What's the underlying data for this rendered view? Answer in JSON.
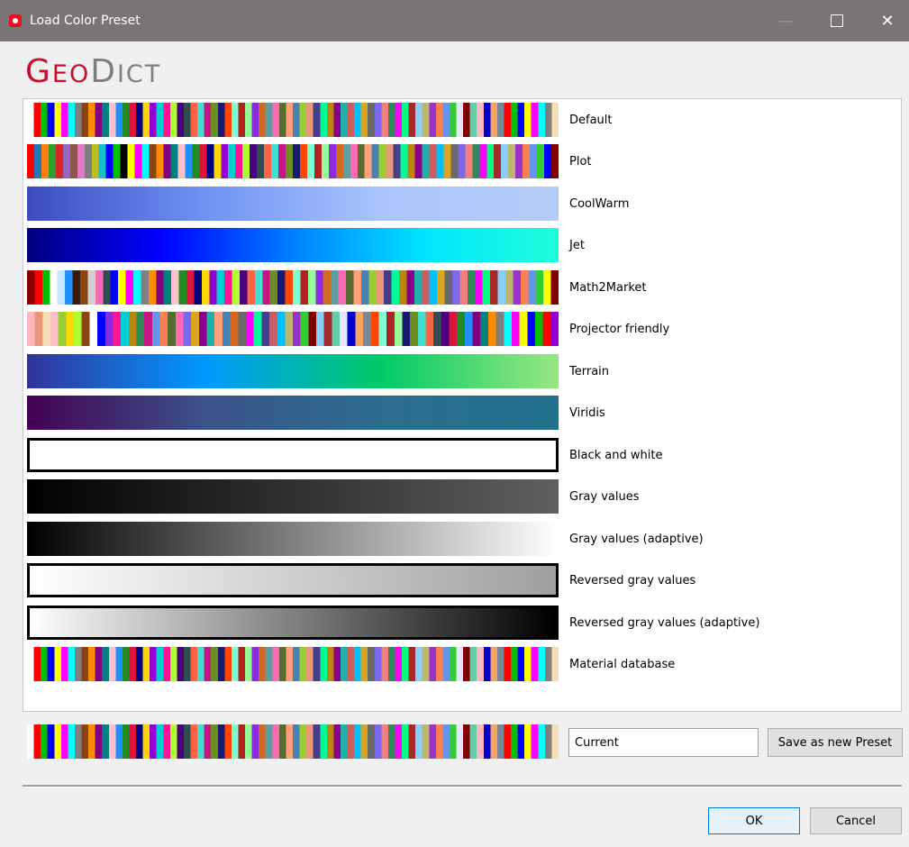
{
  "window": {
    "title": "Load Color Preset",
    "controls": {
      "minimize": "—",
      "close": "✕"
    }
  },
  "logo": {
    "part1_big": "G",
    "part1_small": "EO",
    "part2_big": "D",
    "part2_small": "ICT"
  },
  "presets": [
    {
      "label": "Default",
      "colors": [
        "#ffffff",
        "#ff0000",
        "#00c000",
        "#0000ff",
        "#ffff00",
        "#ff00ff",
        "#00ffff",
        "#808080",
        "#8b4513",
        "#ff8c00",
        "#800080",
        "#008080",
        "#ffc0cb",
        "#1e90ff",
        "#228b22",
        "#dc143c",
        "#000080",
        "#ffd700",
        "#9400d3",
        "#00ced1",
        "#ff1493",
        "#adff2f",
        "#4b0082",
        "#2f4f4f",
        "#ff6347",
        "#40e0d0",
        "#c71585",
        "#6b8e23",
        "#191970",
        "#ff4500",
        "#7fffd4",
        "#b22222",
        "#98fb98",
        "#8a2be2",
        "#d2691e",
        "#5f9ea0",
        "#ff69b4",
        "#556b2f",
        "#ffa07a",
        "#4682b4",
        "#9acd32",
        "#e9967a",
        "#483d8b",
        "#00fa9a",
        "#b8860b",
        "#8b008b",
        "#20b2aa",
        "#cd5c5c",
        "#00bfff",
        "#daa520",
        "#696969",
        "#7b68ee",
        "#f08080",
        "#2e8b57",
        "#ff00ff",
        "#00ff7f",
        "#a52a2a",
        "#87cefa",
        "#bdb76b",
        "#9932cc",
        "#ff7f50",
        "#6495ed",
        "#32cd32",
        "#e6e6fa",
        "#800000",
        "#66cdaa",
        "#ffb6c1",
        "#0000cd",
        "#f4a460",
        "#778899",
        "#ff0000",
        "#00c000",
        "#0000ff",
        "#ffff00",
        "#ff00ff",
        "#00ffff",
        "#808080",
        "#f5deb3"
      ]
    },
    {
      "label": "Plot",
      "colors": [
        "#ff0000",
        "#1f77b4",
        "#ff7f0e",
        "#2ca02c",
        "#d62728",
        "#9467bd",
        "#8c564b",
        "#e377c2",
        "#7f7f7f",
        "#bcbd22",
        "#17becf",
        "#0000ff",
        "#00c000",
        "#000000",
        "#ffff00",
        "#ff00ff",
        "#00ffff",
        "#8b4513",
        "#ff8c00",
        "#800080",
        "#008080",
        "#ffc0cb",
        "#1e90ff",
        "#228b22",
        "#dc143c",
        "#000080",
        "#ffd700",
        "#9400d3",
        "#00ced1",
        "#ff1493",
        "#adff2f",
        "#4b0082",
        "#2f4f4f",
        "#ff6347",
        "#40e0d0",
        "#c71585",
        "#6b8e23",
        "#191970",
        "#ff4500",
        "#7fffd4",
        "#b22222",
        "#98fb98",
        "#8a2be2",
        "#d2691e",
        "#5f9ea0",
        "#ff69b4",
        "#556b2f",
        "#ffa07a",
        "#4682b4",
        "#9acd32",
        "#e9967a",
        "#483d8b",
        "#00fa9a",
        "#b8860b",
        "#8b008b",
        "#20b2aa",
        "#cd5c5c",
        "#00bfff",
        "#daa520",
        "#696969",
        "#7b68ee",
        "#f08080",
        "#2e8b57",
        "#ff00ff",
        "#00ff7f",
        "#a52a2a",
        "#87cefa",
        "#bdb76b",
        "#9932cc",
        "#ff7f50",
        "#6495ed",
        "#32cd32",
        "#0000ff",
        "#800000"
      ]
    },
    {
      "label": "CoolWarm",
      "gradient": [
        "#3b4cc0",
        "#6f92f3",
        "#a9c5fc",
        "#b4cdf6"
      ]
    },
    {
      "label": "Jet",
      "gradient": [
        "#00007f",
        "#0000ff",
        "#007fff",
        "#00e5ff",
        "#1effd9"
      ]
    },
    {
      "label": "Math2Market",
      "colors": [
        "#8b0000",
        "#ff0000",
        "#00c000",
        "#ffffff",
        "#c8e6ff",
        "#1e90ff",
        "#3a1a0a",
        "#8b4513",
        "#d0d0d0",
        "#ff69b4",
        "#2f4f4f",
        "#0000ff",
        "#ffff00",
        "#ff00ff",
        "#00ffff",
        "#808080",
        "#ff8c00",
        "#800080",
        "#008080",
        "#ffc0cb",
        "#228b22",
        "#dc143c",
        "#000080",
        "#ffd700",
        "#9400d3",
        "#00ced1",
        "#ff1493",
        "#adff2f",
        "#4b0082",
        "#ff6347",
        "#40e0d0",
        "#c71585",
        "#6b8e23",
        "#191970",
        "#ff4500",
        "#7fffd4",
        "#b22222",
        "#98fb98",
        "#8a2be2",
        "#d2691e",
        "#5f9ea0",
        "#ff69b4",
        "#556b2f",
        "#ffa07a",
        "#4682b4",
        "#9acd32",
        "#e9967a",
        "#483d8b",
        "#00fa9a",
        "#b8860b",
        "#8b008b",
        "#20b2aa",
        "#cd5c5c",
        "#00bfff",
        "#daa520",
        "#696969",
        "#7b68ee",
        "#f08080",
        "#2e8b57",
        "#ff00ff",
        "#00ff7f",
        "#a52a2a",
        "#87cefa",
        "#bdb76b",
        "#9932cc",
        "#ff7f50",
        "#6495ed",
        "#32cd32",
        "#ffff00",
        "#800000"
      ]
    },
    {
      "label": "Projector friendly",
      "colors": [
        "#ffb6c1",
        "#e9967a",
        "#f5deb3",
        "#ffc0cb",
        "#9acd32",
        "#ffd700",
        "#adff2f",
        "#8b4513",
        "#ffffff",
        "#0000ff",
        "#8a2be2",
        "#ff1493",
        "#00ced1",
        "#b8860b",
        "#2e8b57",
        "#c71585",
        "#6495ed",
        "#ff7f50",
        "#556b2f",
        "#ff69b4",
        "#7b68ee",
        "#daa520",
        "#8b008b",
        "#20b2aa",
        "#ffa07a",
        "#4682b4",
        "#d2691e",
        "#696969",
        "#ff00ff",
        "#00fa9a",
        "#483d8b",
        "#cd5c5c",
        "#00bfff",
        "#bdb76b",
        "#9932cc",
        "#32cd32",
        "#800000",
        "#87cefa",
        "#a52a2a",
        "#66cdaa",
        "#e6e6fa",
        "#0000cd",
        "#f4a460",
        "#778899",
        "#ff4500",
        "#7fffd4",
        "#b22222",
        "#98fb98",
        "#191970",
        "#6b8e23",
        "#40e0d0",
        "#ff6347",
        "#2f4f4f",
        "#4b0082",
        "#dc143c",
        "#228b22",
        "#1e90ff",
        "#800080",
        "#008080",
        "#ff8c00",
        "#808080",
        "#00ffff",
        "#ff00ff",
        "#ffff00",
        "#0000ff",
        "#00c000",
        "#ff0000",
        "#9400d3"
      ]
    },
    {
      "label": "Terrain",
      "gradient": [
        "#333399",
        "#0099ff",
        "#00cc66",
        "#99e680"
      ]
    },
    {
      "label": "Viridis",
      "gradient": [
        "#440154",
        "#3b528b",
        "#2c6e8e",
        "#21728e"
      ]
    },
    {
      "label": "Black and white",
      "gradient": [
        "#ffffff",
        "#ffffff"
      ],
      "bordered": true
    },
    {
      "label": "Gray values",
      "gradient": [
        "#000000",
        "#606060"
      ]
    },
    {
      "label": "Gray values (adaptive)",
      "gradient": [
        "#000000",
        "#ffffff"
      ]
    },
    {
      "label": "Reversed gray values",
      "gradient": [
        "#ffffff",
        "#9f9f9f"
      ],
      "bordered": true
    },
    {
      "label": "Reversed gray values (adaptive)",
      "gradient": [
        "#ffffff",
        "#000000"
      ],
      "bordered": true
    },
    {
      "label": "Material database",
      "colors": [
        "#ffffff",
        "#ff0000",
        "#00c000",
        "#0000ff",
        "#ffff00",
        "#ff00ff",
        "#00ffff",
        "#808080",
        "#8b4513",
        "#ff8c00",
        "#800080",
        "#008080",
        "#ffc0cb",
        "#1e90ff",
        "#228b22",
        "#dc143c",
        "#000080",
        "#ffd700",
        "#9400d3",
        "#00ced1",
        "#ff1493",
        "#adff2f",
        "#4b0082",
        "#2f4f4f",
        "#ff6347",
        "#40e0d0",
        "#c71585",
        "#6b8e23",
        "#191970",
        "#ff4500",
        "#7fffd4",
        "#b22222",
        "#98fb98",
        "#8a2be2",
        "#d2691e",
        "#5f9ea0",
        "#ff69b4",
        "#556b2f",
        "#ffa07a",
        "#4682b4",
        "#9acd32",
        "#e9967a",
        "#483d8b",
        "#00fa9a",
        "#b8860b",
        "#8b008b",
        "#20b2aa",
        "#cd5c5c",
        "#00bfff",
        "#daa520",
        "#696969",
        "#7b68ee",
        "#f08080",
        "#2e8b57",
        "#ff00ff",
        "#00ff7f",
        "#a52a2a",
        "#87cefa",
        "#bdb76b",
        "#9932cc",
        "#ff7f50",
        "#6495ed",
        "#32cd32",
        "#e6e6fa",
        "#800000",
        "#66cdaa",
        "#ffb6c1",
        "#0000cd",
        "#f4a460",
        "#778899",
        "#ff0000",
        "#00c000",
        "#0000ff",
        "#ffff00",
        "#ff00ff",
        "#00ffff",
        "#808080",
        "#f5deb3"
      ]
    }
  ],
  "current": {
    "name_value": "Current",
    "colors": [
      "#ffffff",
      "#ff0000",
      "#00c000",
      "#0000ff",
      "#ffff00",
      "#ff00ff",
      "#00ffff",
      "#808080",
      "#8b4513",
      "#ff8c00",
      "#800080",
      "#008080",
      "#ffc0cb",
      "#1e90ff",
      "#228b22",
      "#dc143c",
      "#000080",
      "#ffd700",
      "#9400d3",
      "#00ced1",
      "#ff1493",
      "#adff2f",
      "#4b0082",
      "#2f4f4f",
      "#ff6347",
      "#40e0d0",
      "#c71585",
      "#6b8e23",
      "#191970",
      "#ff4500",
      "#7fffd4",
      "#b22222",
      "#98fb98",
      "#8a2be2",
      "#d2691e",
      "#5f9ea0",
      "#ff69b4",
      "#556b2f",
      "#ffa07a",
      "#4682b4",
      "#9acd32",
      "#e9967a",
      "#483d8b",
      "#00fa9a",
      "#b8860b",
      "#8b008b",
      "#20b2aa",
      "#cd5c5c",
      "#00bfff",
      "#daa520",
      "#696969",
      "#7b68ee",
      "#f08080",
      "#2e8b57",
      "#ff00ff",
      "#00ff7f",
      "#a52a2a",
      "#87cefa",
      "#bdb76b",
      "#9932cc",
      "#ff7f50",
      "#6495ed",
      "#32cd32",
      "#e6e6fa",
      "#800000",
      "#66cdaa",
      "#ffb6c1",
      "#0000cd",
      "#f4a460",
      "#778899",
      "#ff0000",
      "#00c000",
      "#0000ff",
      "#ffff00",
      "#ff00ff",
      "#00ffff",
      "#808080",
      "#f5deb3"
    ]
  },
  "buttons": {
    "save": "Save as new Preset",
    "ok": "OK",
    "cancel": "Cancel"
  },
  "colors": {
    "titlebar": "#7a7474",
    "logo_red": "#c8102e",
    "logo_gray": "#7f7f7f",
    "ok_border": "#0078d7"
  }
}
